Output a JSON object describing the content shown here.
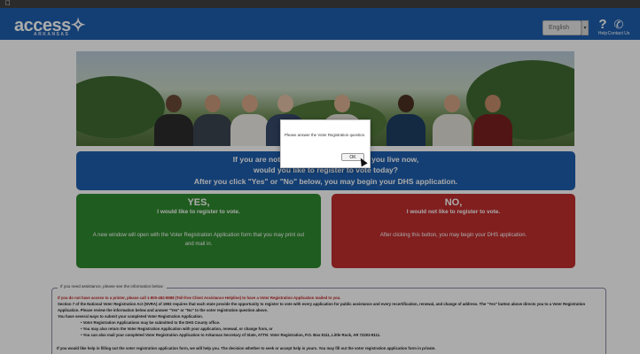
{
  "header": {
    "logo_text": "access✧",
    "logo_subtitle": "ARKANSAS",
    "language": "English",
    "help_label": "Help",
    "contact_label": "Contact Us"
  },
  "voter_question": {
    "line1": "If you are not registered to vote where you live now,",
    "line2": "would you like to register to vote today?",
    "line3": "After you click \"Yes\" or \"No\" below, you may begin your DHS application."
  },
  "yes_card": {
    "title": "YES,",
    "subtitle": "I would like to register to vote.",
    "description": "A new window will open with the Voter Registration Application form that you may print out and mail in."
  },
  "no_card": {
    "title": "NO,",
    "subtitle": "I would not like to register to vote.",
    "description": "After clicking this button, you may begin your DHS application."
  },
  "info": {
    "legend": "If you need assistance, please see the information below:",
    "printer_note": "If you do not have access to a printer, please call 1-800-482-8988 (Toll-free Client Assistance Helpline) to have a Voter Registration Application mailed to you.",
    "nvra_text": "Section 7 of the National Voter Registration Act (NVRA) of 1993 requires that each state provide the opportunity to register to vote with every application for public assistance and every recertification, renewal, and change of address. The \"Yes\" button above directs you to a Voter Registration Application. Please review the information below and answer \"Yes\" or \"No\" to the voter registration question above.",
    "ways_text": "You have several ways to submit your completed Voter Registration Application.",
    "bullets": [
      "• Voter Registration Applications may be submitted to the DHS County office.",
      "• You may also return the Voter Registration Application with your application, renewal, or change from, or",
      "• You can also mail your completed Voter Registration Application to Arkansas Secretary of State, ATTN: Voter Registration, P.O. Box 8111, Little Rock, AR 72203-8111."
    ],
    "help_note": "If you would like help in filling out the voter registration application form, we will help you. The decision whether to seek or accept help is yours. You may fill out the voter registration application form in private."
  },
  "dialog": {
    "message": "Please answer the Voter Registration question.",
    "ok_label": "OK"
  },
  "colors": {
    "brand_blue": "#1f5fae",
    "yes_green": "#2f8a2f",
    "no_red": "#c02d2d"
  }
}
